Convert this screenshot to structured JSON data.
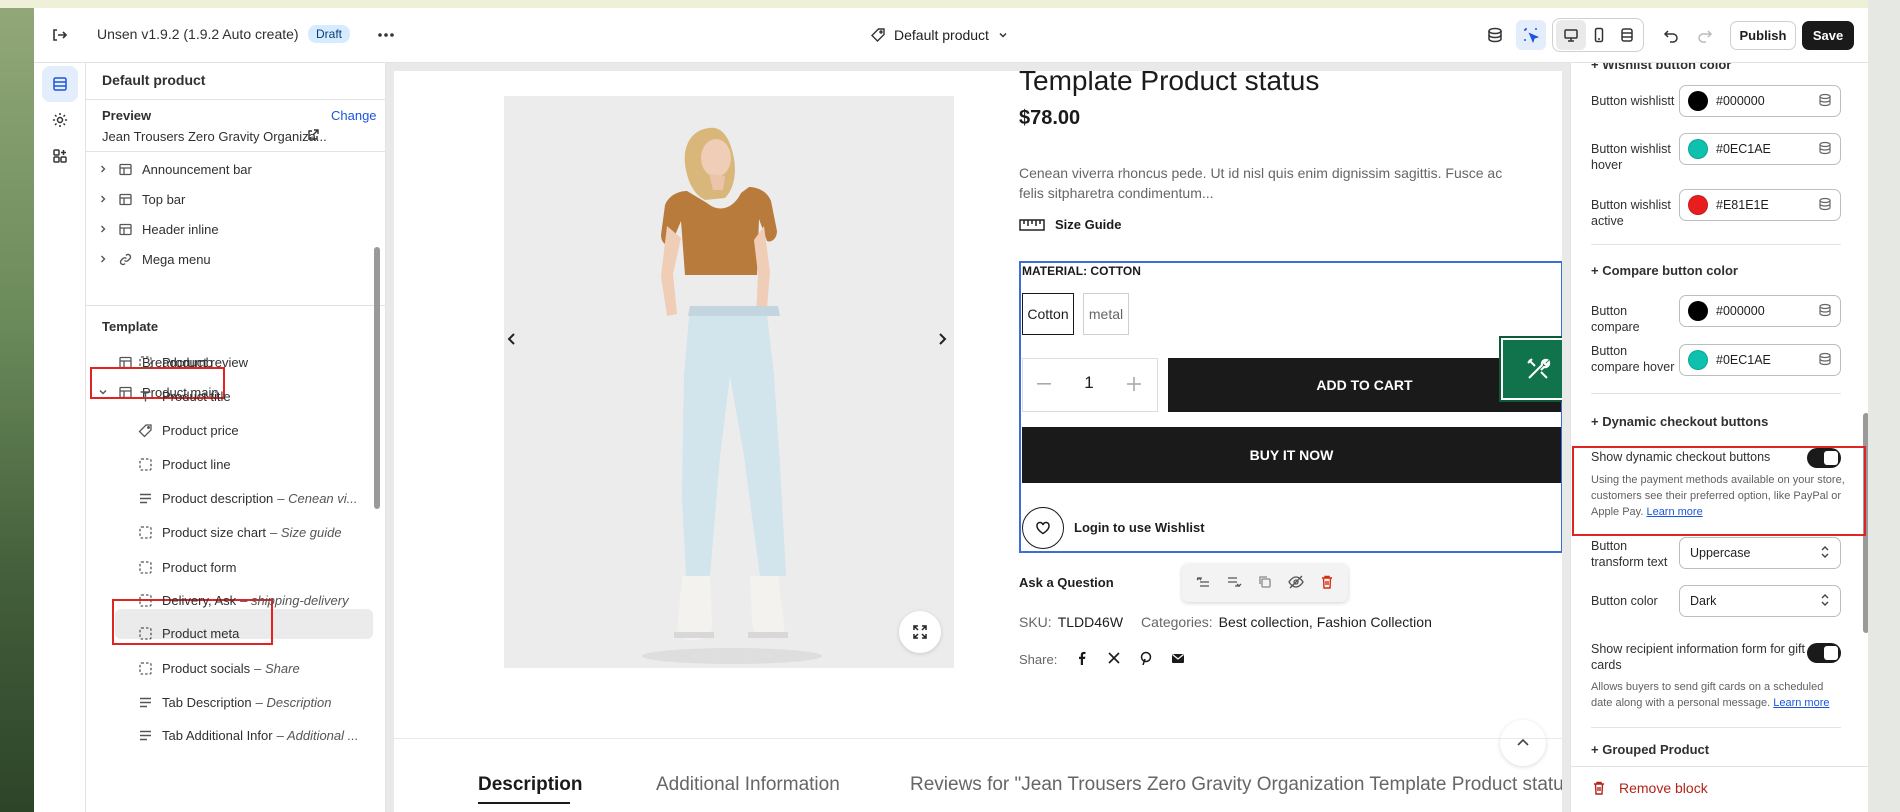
{
  "topbar": {
    "exit_icon": "exit-icon",
    "title": "Unsen v1.9.2 (1.9.2 Auto create)",
    "badge": "Draft",
    "more_icon": "ellipsis-icon",
    "template_name": "Default product",
    "publish_label": "Publish",
    "save_label": "Save"
  },
  "sidebar": {
    "title": "Default product",
    "preview_label": "Preview",
    "change_label": "Change",
    "preview_product": "Jean Trousers Zero Gravity Organiza...",
    "header_items": [
      {
        "label": "Announcement bar"
      },
      {
        "label": "Top bar"
      },
      {
        "label": "Header inline"
      },
      {
        "label": "Mega menu"
      }
    ],
    "template_label": "Template",
    "breadcrumb_label": "Breadcrumb",
    "product_main_label": "Product main",
    "blocks": [
      {
        "label": "Product review",
        "sub": ""
      },
      {
        "label": "Product title",
        "sub": ""
      },
      {
        "label": "Product price",
        "sub": ""
      },
      {
        "label": "Product line",
        "sub": ""
      },
      {
        "label": "Product description",
        "sub": "– Cenean vi..."
      },
      {
        "label": "Product size chart",
        "sub": "– Size guide"
      },
      {
        "label": "Product form",
        "sub": ""
      },
      {
        "label": "Delivery, Ask",
        "sub": "– shipping-delivery"
      },
      {
        "label": "Product meta",
        "sub": ""
      },
      {
        "label": "Product socials",
        "sub": "– Share"
      },
      {
        "label": "Tab Description",
        "sub": "– Description"
      },
      {
        "label": "Tab Additional Infor",
        "sub": "– Additional ..."
      }
    ]
  },
  "product": {
    "title": "Template Product status",
    "price": "$78.00",
    "description": "Cenean viverra rhoncus pede. Ut id nisl quis enim dignissim sagittis. Fusce ac felis sitpharetra condimentum...",
    "size_guide": "Size Guide",
    "material_label": "MATERIAL: COTTON",
    "options": [
      "Cotton",
      "metal"
    ],
    "quantity": "1",
    "add_to_cart": "ADD TO CART",
    "buy_now": "BUY IT NOW",
    "wishlist": "Login to use Wishlist",
    "ask_question": "Ask a Question",
    "sku_label": "SKU:",
    "sku_value": "TLDD46W",
    "categories_label": "Categories:",
    "categories_value": "Best collection, Fashion Collection",
    "share_label": "Share:",
    "tabs": [
      "Description",
      "Additional Information",
      "Reviews for \"Jean Trousers Zero Gravity Organization Template Product status\""
    ]
  },
  "right_panel": {
    "section_top": "+ Wishlist button color",
    "wishlist": [
      {
        "label": "Button wishlistt",
        "value": "#000000",
        "color": "#000000"
      },
      {
        "label": "Button wishlist hover",
        "value": "#0EC1AE",
        "color": "#0EC1AE"
      },
      {
        "label": "Button wishlist active",
        "value": "#E81E1E",
        "color": "#E81E1E"
      }
    ],
    "compare_head": "+ Compare button color",
    "compare": [
      {
        "label": "Button compare",
        "value": "#000000",
        "color": "#000000"
      },
      {
        "label": "Button compare hover",
        "value": "#0EC1AE",
        "color": "#0EC1AE"
      }
    ],
    "dynamic_head": "+ Dynamic checkout buttons",
    "dynamic_toggle_label": "Show dynamic checkout buttons",
    "dynamic_help": "Using the payment methods available on your store, customers see their preferred option, like PayPal or Apple Pay.",
    "learn_more": "Learn more",
    "transform_label": "Button transform text",
    "transform_value": "Uppercase",
    "color_label": "Button color",
    "color_value": "Dark",
    "gift_label": "Show recipient information form for gift cards",
    "gift_help": "Allows buyers to send gift cards on a scheduled date along with a personal message.",
    "grouped_head": "+ Grouped Product",
    "remove_block": "Remove block"
  }
}
